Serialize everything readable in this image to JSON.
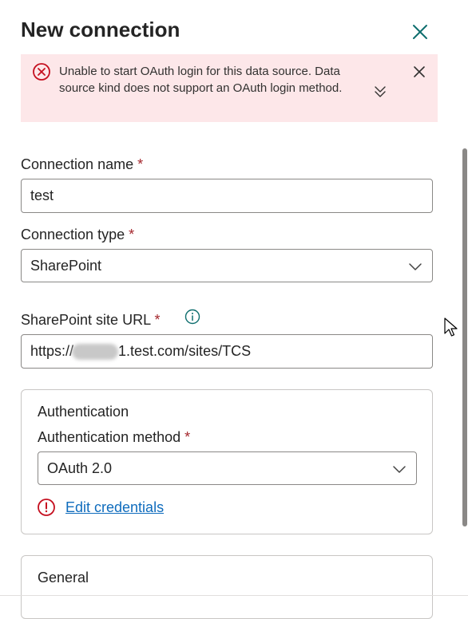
{
  "header": {
    "title": "New connection"
  },
  "banner": {
    "message": "Unable to start OAuth login for this data source. Data source kind does not support an OAuth login method."
  },
  "connection_name": {
    "label": "Connection name",
    "required_mark": "*",
    "value": "test"
  },
  "connection_type": {
    "label": "Connection type",
    "required_mark": "*",
    "value": "SharePoint"
  },
  "site_url": {
    "label": "SharePoint site URL",
    "required_mark": "*",
    "value_prefix": "https://",
    "value_suffix": "1.test.com/sites/TCS"
  },
  "authentication": {
    "section_title": "Authentication",
    "method_label": "Authentication method",
    "required_mark": "*",
    "method_value": "OAuth 2.0",
    "edit_credentials_label": "Edit credentials"
  },
  "general": {
    "section_title": "General"
  },
  "colors": {
    "error_bg": "#fde7e9",
    "error_icon": "#c50f1f",
    "link": "#0f6cbd",
    "required": "#a4262c",
    "accent_teal": "#0e6e6e"
  },
  "icons": [
    "close-icon",
    "error-circle-icon",
    "dismiss-icon",
    "expand-chevrons-icon",
    "chevron-down-icon",
    "info-icon",
    "warning-circle-icon",
    "mouse-pointer-icon"
  ]
}
